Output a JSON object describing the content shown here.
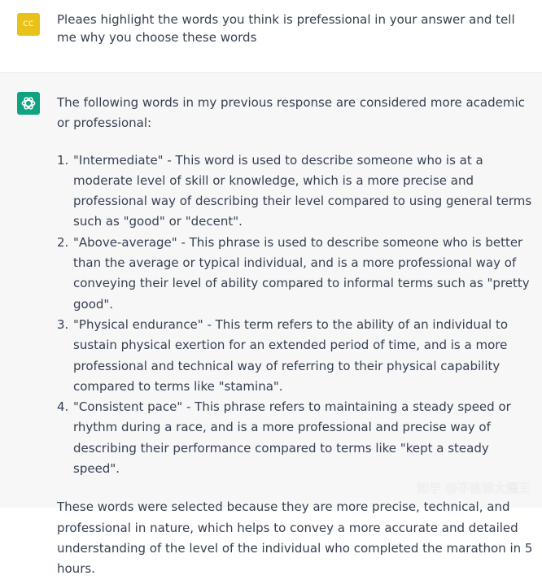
{
  "user_message": {
    "avatar_initials": "CC",
    "avatar_color": "#e8c21a",
    "text": "Pleaes highlight the words you think is prefessional in your answer and tell me why you choose these words"
  },
  "assistant_message": {
    "avatar_icon": "openai-logo-icon",
    "avatar_color": "#10a37f",
    "intro": "The following words in my previous response are considered more academic or professional:",
    "points": [
      {
        "number": "1.",
        "text": "\"Intermediate\" - This word is used to describe someone who is at a moderate level of skill or knowledge, which is a more precise and professional way of describing their level compared to using general terms such as \"good\" or \"decent\"."
      },
      {
        "number": "2.",
        "text": "\"Above-average\" - This phrase is used to describe someone who is better than the average or typical individual, and is a more professional way of conveying their level of ability compared to informal terms such as \"pretty good\"."
      },
      {
        "number": "3.",
        "text": "\"Physical endurance\" - This term refers to the ability of an individual to sustain physical exertion for an extended period of time, and is a more professional and technical way of referring to their physical capability compared to terms like \"stamina\"."
      },
      {
        "number": "4.",
        "text": "\"Consistent pace\" - This phrase refers to maintaining a steady speed or rhythm during a race, and is a more professional and precise way of describing their performance compared to terms like \"kept a steady speed\"."
      }
    ],
    "closing": "These words were selected because they are more precise, technical, and professional in nature, which helps to convey a more accurate and detailed understanding of the level of the individual who completed the marathon in 5 hours."
  },
  "watermark": "知乎 @不信邪大魔王"
}
